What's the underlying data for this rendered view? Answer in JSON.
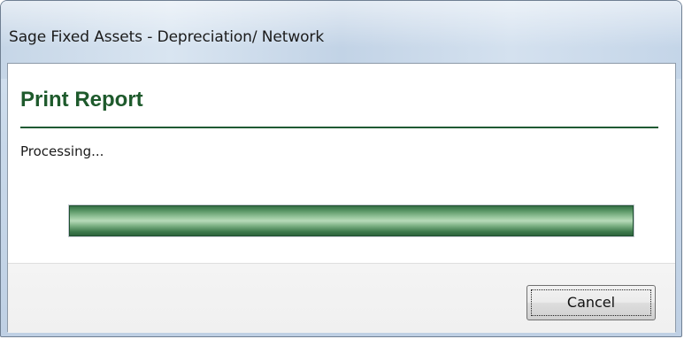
{
  "window": {
    "title": "Sage Fixed Assets - Depreciation/ Network"
  },
  "dialog": {
    "header": "Print Report",
    "status": "Processing..."
  },
  "progress": {
    "value_percent": 100,
    "color": "#2f6b40"
  },
  "buttons": {
    "cancel_label": "Cancel"
  },
  "colors": {
    "accent": "#1e5a2c",
    "titlebar": "#c9d9ea"
  }
}
